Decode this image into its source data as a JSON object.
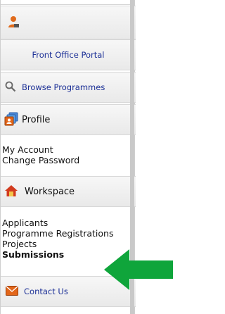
{
  "nav": {
    "portal_link": "Front Office Portal",
    "browse_link": "Browse Programmes",
    "profile_header": "Profile",
    "profile_links": [
      "My Account",
      "Change Password"
    ],
    "workspace_header": "Workspace",
    "workspace_links": [
      "Applicants",
      "Programme Registrations",
      "Projects",
      "Submissions"
    ],
    "contact_link": "Contact Us"
  },
  "icons": {
    "user": "user-icon",
    "search": "search-icon",
    "profile": "profile-cards-icon",
    "home": "home-icon",
    "mail": "mail-icon",
    "arrow": "arrow-left-icon"
  },
  "colors": {
    "link_blue": "#1b2f96",
    "arrow_green": "#0fa53b",
    "user_orange": "#e06b1c"
  }
}
